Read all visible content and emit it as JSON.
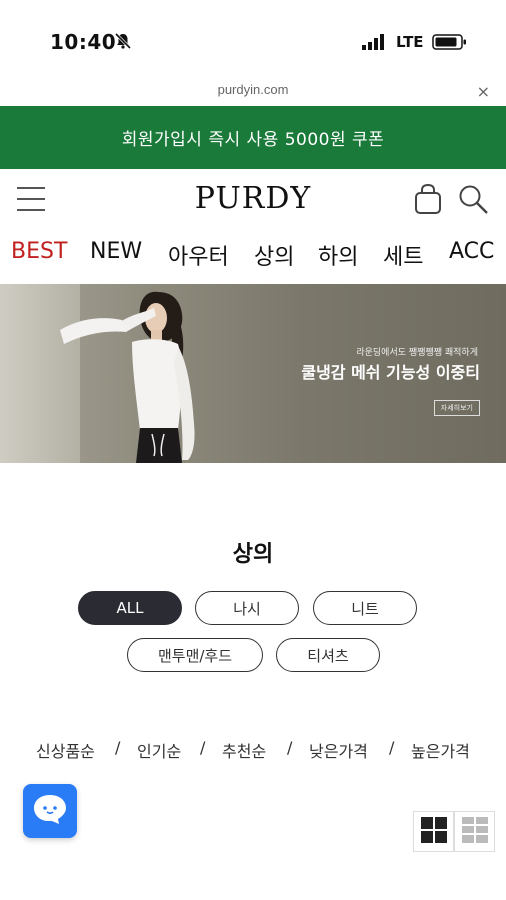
{
  "status": {
    "time": "10:40",
    "network": "LTE"
  },
  "browser": {
    "url": "purdyin.com",
    "close_label": "×"
  },
  "promo": {
    "text": "회원가입시 즉시 사용 5000원 쿠폰"
  },
  "header": {
    "logo": "PURDY"
  },
  "nav": {
    "items": [
      "BEST",
      "NEW",
      "아우터",
      "상의",
      "하의",
      "세트",
      "ACC"
    ],
    "active": "BEST"
  },
  "hero": {
    "small_text": "라운딩에서도 쨍쨍쨍쨍 쾌적하게",
    "title": "쿨냉감 메쉬 기능성 이중티",
    "button": "자세히보기"
  },
  "page": {
    "title": "상의"
  },
  "filters": {
    "chips": [
      "ALL",
      "나시",
      "니트",
      "맨투맨/후드",
      "티셔츠"
    ],
    "active": "ALL"
  },
  "sort": {
    "options": [
      "신상품순",
      "인기순",
      "추천순",
      "낮은가격",
      "높은가격"
    ],
    "separator": "/"
  },
  "colors": {
    "promo_green": "#1a7a3a",
    "best_red": "#c0201f",
    "chip_active": "#2b2b33",
    "chat_blue": "#2a7bf6"
  },
  "icons": [
    "bell-off-icon",
    "signal-icon",
    "battery-icon",
    "menu-icon",
    "shopping-bag-icon",
    "search-icon",
    "chat-icon",
    "grid-view-icon",
    "list-view-icon"
  ]
}
